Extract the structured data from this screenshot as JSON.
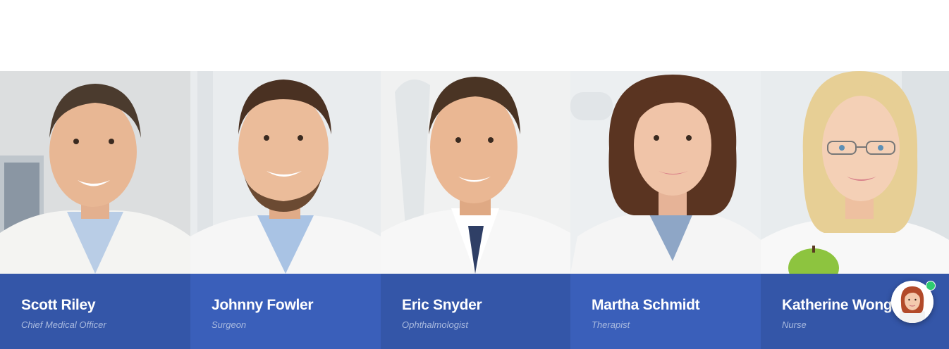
{
  "team": {
    "members": [
      {
        "name": "Scott Riley",
        "role": "Chief Medical Officer"
      },
      {
        "name": "Johnny Fowler",
        "role": "Surgeon"
      },
      {
        "name": "Eric Snyder",
        "role": "Ophthalmologist"
      },
      {
        "name": "Martha Schmidt",
        "role": "Therapist"
      },
      {
        "name": "Katherine Wong",
        "role": "Nurse"
      }
    ]
  },
  "chat_widget": {
    "status": "online",
    "status_color": "#2ecc71"
  },
  "colors": {
    "card_footer_dark": "#3456a8",
    "card_footer_light": "#3a5fba",
    "name_text": "#ffffff",
    "role_text": "#a9badf"
  }
}
